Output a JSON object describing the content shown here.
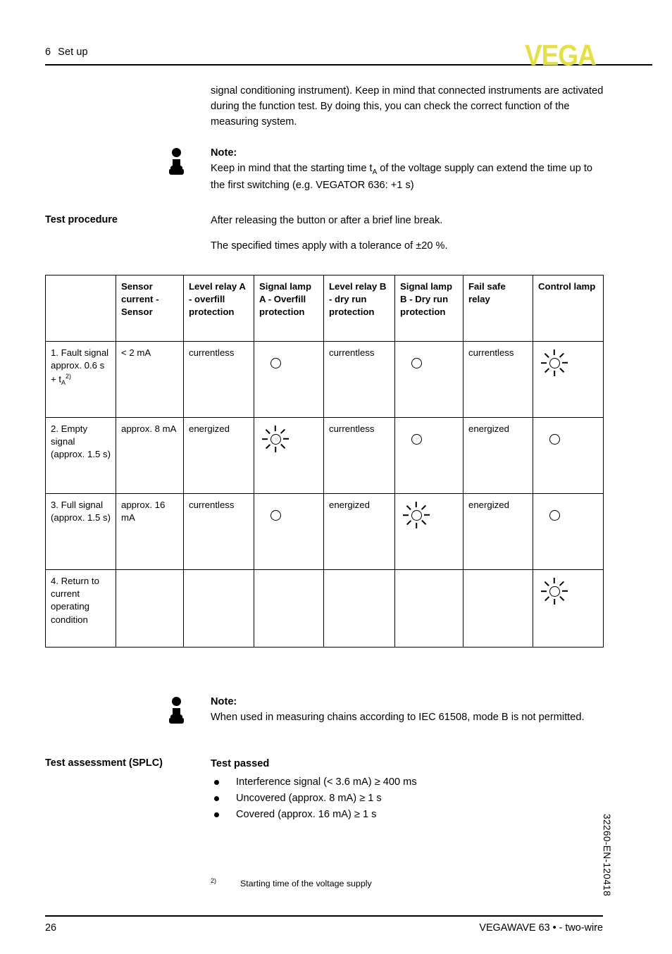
{
  "header": {
    "chapter_number": "6",
    "chapter_title": "Set up",
    "logo_text": "VEGA",
    "logo_color": "#e4e04a"
  },
  "intro_paragraph": "signal conditioning instrument). Keep in mind that connected instruments are activated during the function test. By doing this, you can check the correct function of the measuring system.",
  "note_top": {
    "title": "Note:",
    "text_before_sub": "Keep in mind that the starting time t",
    "sub": "A",
    "text_after_sub": " of the voltage supply can extend the time up to the first switching (e.g. VEGATOR 636: +1 s)"
  },
  "test_procedure": {
    "label": "Test procedure",
    "paragraph_1": "After releasing the button or after a brief line break.",
    "paragraph_2": "The specified times apply with a tolerance of ±20 %."
  },
  "table": {
    "headers": [
      "",
      "Sensor current - Sensor",
      "Level relay A - overfill protection",
      "Signal lamp A - Overfill protection",
      "Level relay B - dry run protection",
      "Signal lamp B - Dry run protection",
      "Fail safe relay",
      "Control lamp"
    ],
    "rows": [
      {
        "step": "1. Fault signal approx. 0.6 s + t",
        "step_sub": "A",
        "step_sup": "2)",
        "sensor_current": "< 2 mA",
        "level_relay_a": "currentless",
        "signal_lamp_a": "off",
        "level_relay_b": "currentless",
        "signal_lamp_b": "off",
        "fail_safe_relay": "currentless",
        "control_lamp": "on"
      },
      {
        "step": "2. Empty signal (approx. 1.5 s)",
        "sensor_current": "approx. 8 mA",
        "level_relay_a": "energized",
        "signal_lamp_a": "on",
        "level_relay_b": "currentless",
        "signal_lamp_b": "off",
        "fail_safe_relay": "energized",
        "control_lamp": "off"
      },
      {
        "step": "3. Full signal (approx. 1.5 s)",
        "sensor_current": "approx. 16 mA",
        "level_relay_a": "currentless",
        "signal_lamp_a": "off",
        "level_relay_b": "energized",
        "signal_lamp_b": "on",
        "fail_safe_relay": "energized",
        "control_lamp": "off"
      },
      {
        "step": "4. Return to current operating condition",
        "sensor_current": "",
        "level_relay_a": "",
        "signal_lamp_a": "",
        "level_relay_b": "",
        "signal_lamp_b": "",
        "fail_safe_relay": "",
        "control_lamp": "on"
      }
    ]
  },
  "note_bottom": {
    "title": "Note:",
    "text": "When used in measuring chains according to IEC 61508, mode B is not permitted."
  },
  "test_assessment": {
    "label": "Test assessment (SPLC)",
    "heading": "Test passed",
    "bullets": [
      "Interference signal (< 3.6 mA) ≥ 400 ms",
      "Uncovered (approx. 8 mA) ≥ 1 s",
      "Covered (approx. 16 mA) ≥ 1 s"
    ]
  },
  "footnote": {
    "marker": "2)",
    "text": "Starting time of the voltage supply"
  },
  "footer": {
    "page_number": "26",
    "product": "VEGAWAVE 63 • - two-wire",
    "document_number": "32260-EN-120418"
  }
}
